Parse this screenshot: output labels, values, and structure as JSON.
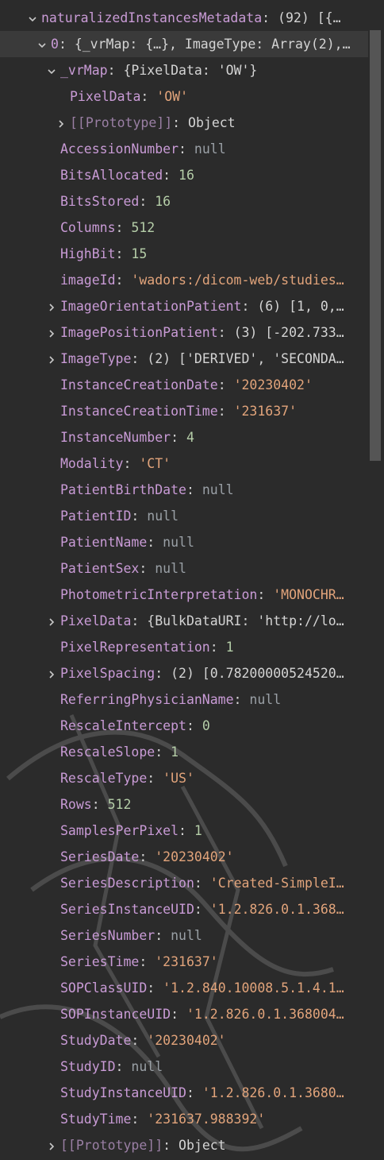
{
  "root": {
    "key": "naturalizedInstancesMetadata",
    "preview": "(92) [{…",
    "expanded": true
  },
  "item0": {
    "key": "0",
    "preview": "{_vrMap: {…}, ImageType: Array(2),…",
    "expanded": true
  },
  "vrMap": {
    "key": "_vrMap",
    "preview": "{PixelData: 'OW'}",
    "expanded": true,
    "children": [
      {
        "key": "PixelData",
        "value": "'OW'",
        "type": "string"
      }
    ],
    "prototype": {
      "key": "[[Prototype]]",
      "value": "Object"
    }
  },
  "fields": [
    {
      "key": "AccessionNumber",
      "value": "null",
      "type": "null",
      "expandable": false
    },
    {
      "key": "BitsAllocated",
      "value": "16",
      "type": "number",
      "expandable": false
    },
    {
      "key": "BitsStored",
      "value": "16",
      "type": "number",
      "expandable": false
    },
    {
      "key": "Columns",
      "value": "512",
      "type": "number",
      "expandable": false
    },
    {
      "key": "HighBit",
      "value": "15",
      "type": "number",
      "expandable": false
    },
    {
      "key": "imageId",
      "value": "'wadors:/dicom-web/studies…",
      "type": "string",
      "expandable": false
    },
    {
      "key": "ImageOrientationPatient",
      "value": "(6) [1, 0,…",
      "type": "object",
      "expandable": true
    },
    {
      "key": "ImagePositionPatient",
      "value": "(3) [-202.733…",
      "type": "object",
      "expandable": true
    },
    {
      "key": "ImageType",
      "value": "(2) ['DERIVED', 'SECONDA…",
      "type": "object",
      "expandable": true
    },
    {
      "key": "InstanceCreationDate",
      "value": "'20230402'",
      "type": "string",
      "expandable": false
    },
    {
      "key": "InstanceCreationTime",
      "value": "'231637'",
      "type": "string",
      "expandable": false
    },
    {
      "key": "InstanceNumber",
      "value": "4",
      "type": "number",
      "expandable": false
    },
    {
      "key": "Modality",
      "value": "'CT'",
      "type": "string",
      "expandable": false
    },
    {
      "key": "PatientBirthDate",
      "value": "null",
      "type": "null",
      "expandable": false
    },
    {
      "key": "PatientID",
      "value": "null",
      "type": "null",
      "expandable": false
    },
    {
      "key": "PatientName",
      "value": "null",
      "type": "null",
      "expandable": false
    },
    {
      "key": "PatientSex",
      "value": "null",
      "type": "null",
      "expandable": false
    },
    {
      "key": "PhotometricInterpretation",
      "value": "'MONOCHR…",
      "type": "string",
      "expandable": false
    },
    {
      "key": "PixelData",
      "value": "{BulkDataURI: 'http://lo…",
      "type": "object",
      "expandable": true
    },
    {
      "key": "PixelRepresentation",
      "value": "1",
      "type": "number",
      "expandable": false
    },
    {
      "key": "PixelSpacing",
      "value": "(2) [0.78200000524520…",
      "type": "object",
      "expandable": true
    },
    {
      "key": "ReferringPhysicianName",
      "value": "null",
      "type": "null",
      "expandable": false
    },
    {
      "key": "RescaleIntercept",
      "value": "0",
      "type": "number",
      "expandable": false
    },
    {
      "key": "RescaleSlope",
      "value": "1",
      "type": "number",
      "expandable": false
    },
    {
      "key": "RescaleType",
      "value": "'US'",
      "type": "string",
      "expandable": false
    },
    {
      "key": "Rows",
      "value": "512",
      "type": "number",
      "expandable": false
    },
    {
      "key": "SamplesPerPixel",
      "value": "1",
      "type": "number",
      "expandable": false
    },
    {
      "key": "SeriesDate",
      "value": "'20230402'",
      "type": "string",
      "expandable": false
    },
    {
      "key": "SeriesDescription",
      "value": "'Created-SimpleI…",
      "type": "string",
      "expandable": false
    },
    {
      "key": "SeriesInstanceUID",
      "value": "'1.2.826.0.1.368…",
      "type": "string",
      "expandable": false
    },
    {
      "key": "SeriesNumber",
      "value": "null",
      "type": "null",
      "expandable": false
    },
    {
      "key": "SeriesTime",
      "value": "'231637'",
      "type": "string",
      "expandable": false
    },
    {
      "key": "SOPClassUID",
      "value": "'1.2.840.10008.5.1.4.1…",
      "type": "string",
      "expandable": false
    },
    {
      "key": "SOPInstanceUID",
      "value": "'1.2.826.0.1.368004…",
      "type": "string",
      "expandable": false
    },
    {
      "key": "StudyDate",
      "value": "'20230402'",
      "type": "string",
      "expandable": false
    },
    {
      "key": "StudyID",
      "value": "null",
      "type": "null",
      "expandable": false
    },
    {
      "key": "StudyInstanceUID",
      "value": "'1.2.826.0.1.3680…",
      "type": "string",
      "expandable": false
    },
    {
      "key": "StudyTime",
      "value": "'231637.988392'",
      "type": "string",
      "expandable": false
    }
  ],
  "prototype": {
    "key": "[[Prototype]]",
    "value": "Object"
  },
  "icons": {
    "expanded": "chevron-down-icon",
    "collapsed": "chevron-right-icon"
  },
  "colors": {
    "background": "#2b2b2b",
    "key": "#c99bd6",
    "string": "#e2a47b",
    "number": "#b5cea8",
    "null": "#9aa0a6",
    "text": "#d4d4d4"
  }
}
